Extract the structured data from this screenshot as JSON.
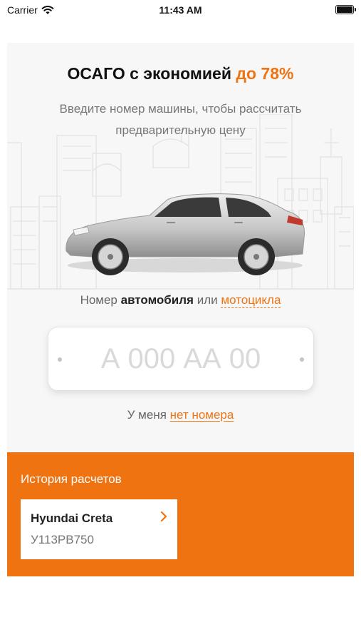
{
  "status_bar": {
    "carrier": "Carrier",
    "time": "11:43 AM"
  },
  "hero": {
    "title_main": "ОСАГО с экономией",
    "title_accent": "до 78%",
    "subtitle": "Введите номер машины, чтобы рассчитать предварительную цену",
    "plate_label_prefix": "Номер",
    "plate_label_car": "автомобиля",
    "plate_label_or": "или",
    "plate_label_moto": "мотоцикла",
    "plate_placeholder": "А 000 АА 00",
    "no_number_prefix": "У меня",
    "no_number_link": "нет номера"
  },
  "history": {
    "title": "История расчетов",
    "items": [
      {
        "model": "Hyundai Creta",
        "plate": "У113РВ750"
      }
    ]
  },
  "colors": {
    "accent": "#f07312",
    "hero_background": "#f7f7f7",
    "car_body": "#c9c9c9"
  }
}
